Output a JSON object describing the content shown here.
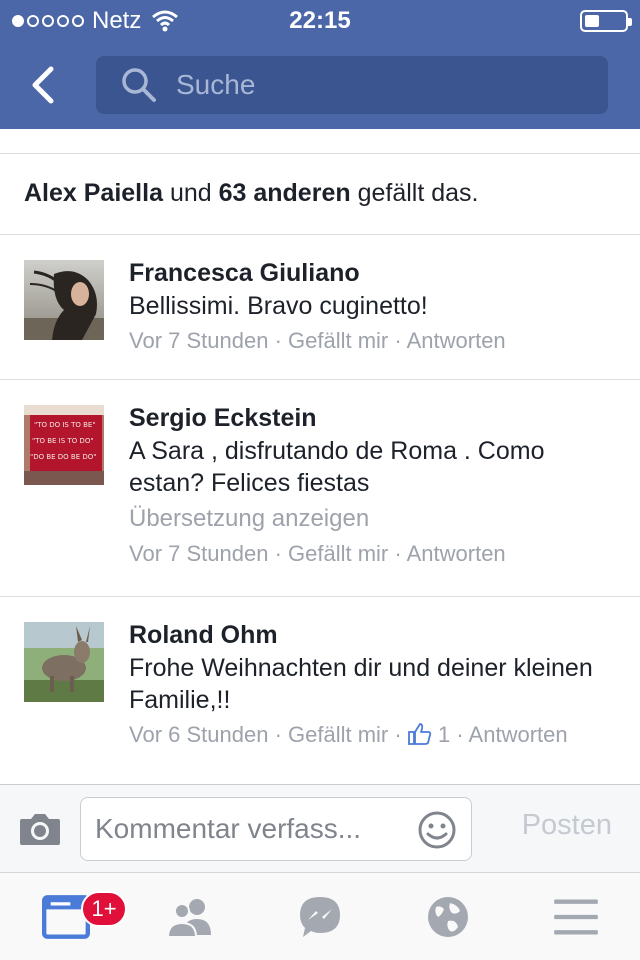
{
  "status_bar": {
    "carrier": "Netz",
    "time": "22:15",
    "signal_dots_filled": 1,
    "signal_dots_total": 5,
    "battery_level": 0.3
  },
  "nav": {
    "back_icon": "chevron-left-icon",
    "search_placeholder": "Suche"
  },
  "likes": {
    "name": "Alex Paiella",
    "connector": "und",
    "others": "63 anderen",
    "suffix": "gefällt das."
  },
  "comments": [
    {
      "author": "Francesca Giuliano",
      "text": "Bellissimi. Bravo cuginetto!",
      "time": "Vor 7 Stunden",
      "like_label": "Gefällt mir",
      "reply_label": "Antworten"
    },
    {
      "author": "Sergio Eckstein",
      "text": "A Sara , disfrutando de Roma . Como estan? Felices fiestas",
      "translate_label": "Übersetzung anzeigen",
      "time": "Vor 7 Stunden",
      "like_label": "Gefällt mir",
      "reply_label": "Antworten",
      "avatar_text": [
        "\"TO DO IS TO BE\"",
        "\"TO BE IS TO DO\"",
        "\"DO BE DO BE DO\""
      ]
    },
    {
      "author": "Roland Ohm",
      "text": "Frohe Weihnachten dir und deiner kleinen Familie,!!",
      "time": "Vor 6 Stunden",
      "like_label": "Gefällt mir",
      "like_count": "1",
      "reply_label": "Antworten"
    }
  ],
  "composer": {
    "placeholder": "Kommentar verfass...",
    "post_label": "Posten"
  },
  "tabbar": {
    "badge": "1+",
    "tabs": [
      "news-feed-icon",
      "friends-icon",
      "messenger-icon",
      "globe-icon",
      "menu-icon"
    ]
  },
  "colors": {
    "brand": "#4b67a8",
    "search_bg": "#3b5591",
    "badge": "#e0103a",
    "muted": "#9da2ab",
    "active_tab": "#4b7bd8"
  }
}
